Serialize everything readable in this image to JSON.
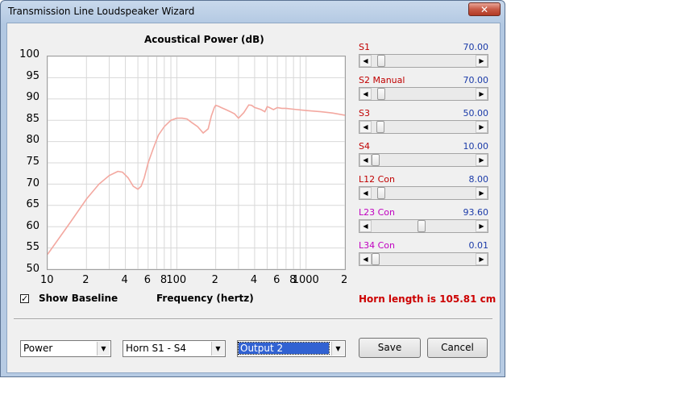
{
  "window": {
    "title": "Transmission Line Loudspeaker Wizard",
    "close_glyph": "✕"
  },
  "chart": {
    "title": "Acoustical Power (dB)",
    "xlabel": "Frequency (hertz)",
    "y_ticks": [
      "100",
      "95",
      "90",
      "85",
      "80",
      "75",
      "70",
      "65",
      "60",
      "55",
      "50"
    ],
    "x_ticks": [
      "10",
      "2",
      "4",
      "6",
      "8",
      "100",
      "2",
      "4",
      "6",
      "8",
      "1000",
      "2"
    ]
  },
  "chart_data": {
    "type": "line",
    "title": "Acoustical Power (dB)",
    "xlabel": "Frequency (hertz)",
    "ylabel": "",
    "xscale": "log",
    "xlim": [
      10,
      2000
    ],
    "ylim": [
      50,
      100
    ],
    "grid": true,
    "color": "#f3a8a0",
    "series": [
      {
        "x": [
          10,
          15,
          20,
          25,
          30,
          35,
          38,
          42,
          46,
          50,
          53,
          56,
          60,
          66,
          72,
          80,
          90,
          100,
          110,
          120,
          130,
          145,
          160,
          175,
          185,
          195,
          200,
          210,
          220,
          240,
          260,
          280,
          300,
          330,
          360,
          380,
          400,
          420,
          450,
          480,
          500,
          520,
          560,
          600,
          650,
          700,
          800,
          1000,
          1300,
          1600,
          2000
        ],
        "y": [
          53.5,
          61,
          66.5,
          70,
          72,
          73,
          72.8,
          71.5,
          69.5,
          68.8,
          69.5,
          71.5,
          75,
          78.5,
          81.5,
          83.5,
          85,
          85.5,
          85.5,
          85.3,
          84.5,
          83.5,
          82,
          83,
          86,
          88,
          88.5,
          88.3,
          88,
          87.5,
          87,
          86.5,
          85.5,
          86.8,
          88.6,
          88.5,
          88,
          87.8,
          87.5,
          87,
          88.2,
          88,
          87.5,
          88,
          87.8,
          87.8,
          87.6,
          87.3,
          87,
          86.7,
          86.2
        ]
      }
    ]
  },
  "options": {
    "show_baseline_label": "Show Baseline",
    "show_baseline_checked": "✓"
  },
  "sliders": [
    {
      "name": "S1",
      "value": "70.00",
      "name_color": "#c00000",
      "level": 0.06
    },
    {
      "name": "S2  Manual",
      "value": "70.00",
      "name_color": "#c00000",
      "level": 0.06
    },
    {
      "name": "S3",
      "value": "50.00",
      "name_color": "#c00000",
      "level": 0.05
    },
    {
      "name": "S4",
      "value": "10.00",
      "name_color": "#c00000",
      "level": 0.0
    },
    {
      "name": "L12  Con",
      "value": "8.00",
      "name_color": "#c00000",
      "level": 0.06
    },
    {
      "name": "L23  Con",
      "value": "93.60",
      "name_color": "#c000c0",
      "level": 0.47
    },
    {
      "name": "L34  Con",
      "value": "0.01",
      "name_color": "#c000c0",
      "level": 0.0
    }
  ],
  "slider_arrows": {
    "left": "◀",
    "right": "▶"
  },
  "horn_length": "Horn length is 105.81 cm",
  "combos": [
    {
      "value": "Power"
    },
    {
      "value": "Horn S1 - S4"
    },
    {
      "value": "Output 2"
    }
  ],
  "combo_arrow": "▼",
  "buttons": {
    "save": "Save",
    "cancel": "Cancel"
  }
}
